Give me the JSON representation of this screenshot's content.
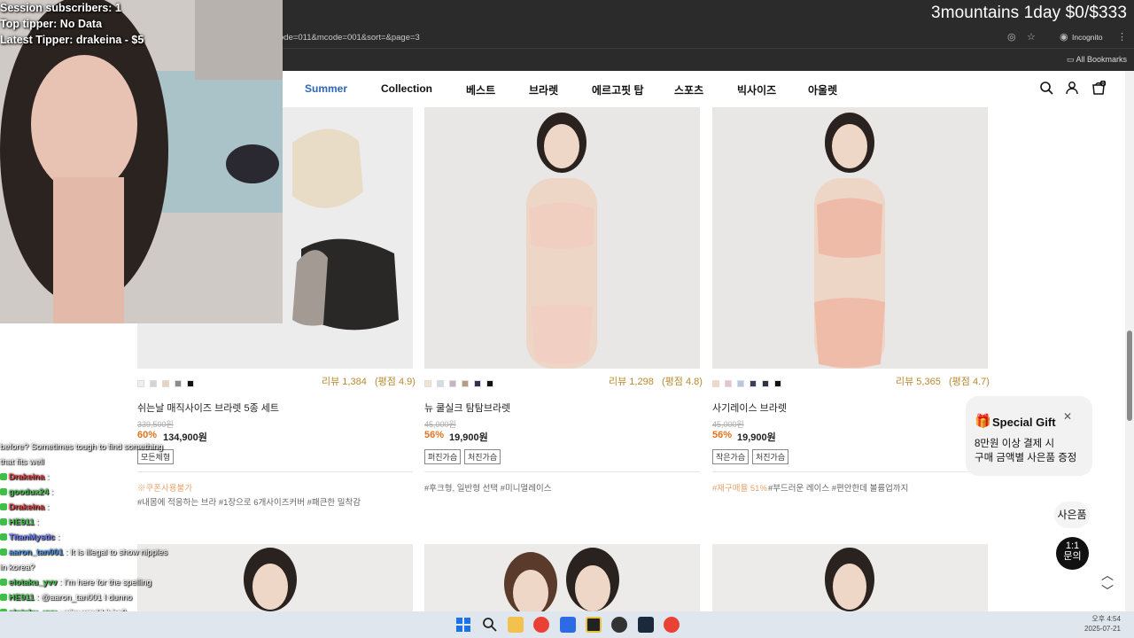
{
  "stream": {
    "goal_text": "3mountains 1day $0/$333",
    "overlay_lines": [
      "Session subscribers: 1",
      "Top tipper: No Data",
      "Latest Tipper: drakeina - $5"
    ]
  },
  "browser": {
    "url_fragment": "ode=011&mcode=001&sort=&page=3",
    "incognito_label": "Incognito",
    "bookmarks_label": "All Bookmarks"
  },
  "nav": {
    "items": [
      {
        "label": "Summer",
        "active": true
      },
      {
        "label": "Collection",
        "active": false
      },
      {
        "label": "베스트",
        "active": false
      },
      {
        "label": "브라렛",
        "active": false
      },
      {
        "label": "에르고핏 탑",
        "active": false
      },
      {
        "label": "스포츠",
        "active": false
      },
      {
        "label": "빅사이즈",
        "active": false
      },
      {
        "label": "아울렛",
        "active": false
      }
    ],
    "cart_count": "0"
  },
  "products": [
    {
      "name": "쉬는날 매직사이즈 브라렛 5종 세트",
      "review": "리뷰 1,384",
      "rating": "(평점 4.9)",
      "old_price": "339,500원",
      "discount": "60%",
      "price": "134,900원",
      "tags": [
        "모든체형"
      ],
      "coupon": "※쿠폰사용불가",
      "hashtags": "#내몸에 적응하는 브라   #1장으로 6개사이즈커버   #패큰한 밀착감",
      "swatches": [
        "#eeeeee",
        "#d9d2cf",
        "#e9d3bd",
        "#8c8a86",
        "#111111"
      ]
    },
    {
      "name": "뉴 쿨실크 탐탐브라렛",
      "review": "리뷰 1,298",
      "rating": "(평점 4.8)",
      "old_price": "45,000원",
      "discount": "56%",
      "price": "19,900원",
      "tags": [
        "퍼진가슴",
        "처진가슴"
      ],
      "coupon": "",
      "hashtags": "#후크형, 일반형 선택   #미니멀레이스",
      "swatches": [
        "#f3e3d3",
        "#d4dbe5",
        "#c9b3c3",
        "#b59a84",
        "#2f3350",
        "#111111"
      ]
    },
    {
      "name": "사기레이스 브라렛",
      "review": "리뷰 5,365",
      "rating": "(평점 4.7)",
      "old_price": "45,000원",
      "discount": "56%",
      "price": "19,900원",
      "tags": [
        "작은가슴",
        "처진가슴"
      ],
      "coupon": "#재구매율 51%",
      "hashtags": "#부드러운 레이스   #편안한데 볼륨업까지",
      "swatches": [
        "#f2d8c2",
        "#e8c4c8",
        "#b9c6df",
        "#3a3f5a",
        "#2e3344",
        "#111111"
      ]
    }
  ],
  "gift": {
    "title": "Special Gift",
    "line1": "8만원 이상 결제 시",
    "line2": "구매 금액별 사은품 증정"
  },
  "side_buttons": {
    "gift_label": "사은품",
    "chat_line1": "1:1",
    "chat_line2": "문의"
  },
  "chat": [
    {
      "user": "",
      "msg": "before? Sometimes tough to find something",
      "color": "#ffffff"
    },
    {
      "user": "",
      "msg": "that fits well",
      "color": "#ffffff"
    },
    {
      "user": "Drakeina",
      "msg": ":",
      "color": "#e23b3b"
    },
    {
      "user": "goodux24",
      "msg": ":",
      "color": "#3fbf4a"
    },
    {
      "user": "Drakeina",
      "msg": ":",
      "color": "#e23b3b"
    },
    {
      "user": "HE911",
      "msg": ":",
      "color": "#3fbf4a"
    },
    {
      "user": "TitanMystic",
      "msg": ":",
      "color": "#6b7cff"
    },
    {
      "user": "aaron_tan001",
      "msg": ": It is illegal to show nipples",
      "color": "#4a90e2"
    },
    {
      "user": "",
      "msg": "in korea?",
      "color": "#ffffff"
    },
    {
      "user": "elotaku_yvv",
      "msg": ": I'm here for the spelling",
      "color": "#3fbf4a"
    },
    {
      "user": "HE911",
      "msg": ": @aaron_tan001 I dunno",
      "color": "#3fbf4a"
    },
    {
      "user": "elotaku_yvv",
      "msg": ": why would it be?",
      "color": "#3fbf4a"
    }
  ],
  "clock": {
    "time": "오후 4:54",
    "date": "2025-07-21"
  }
}
